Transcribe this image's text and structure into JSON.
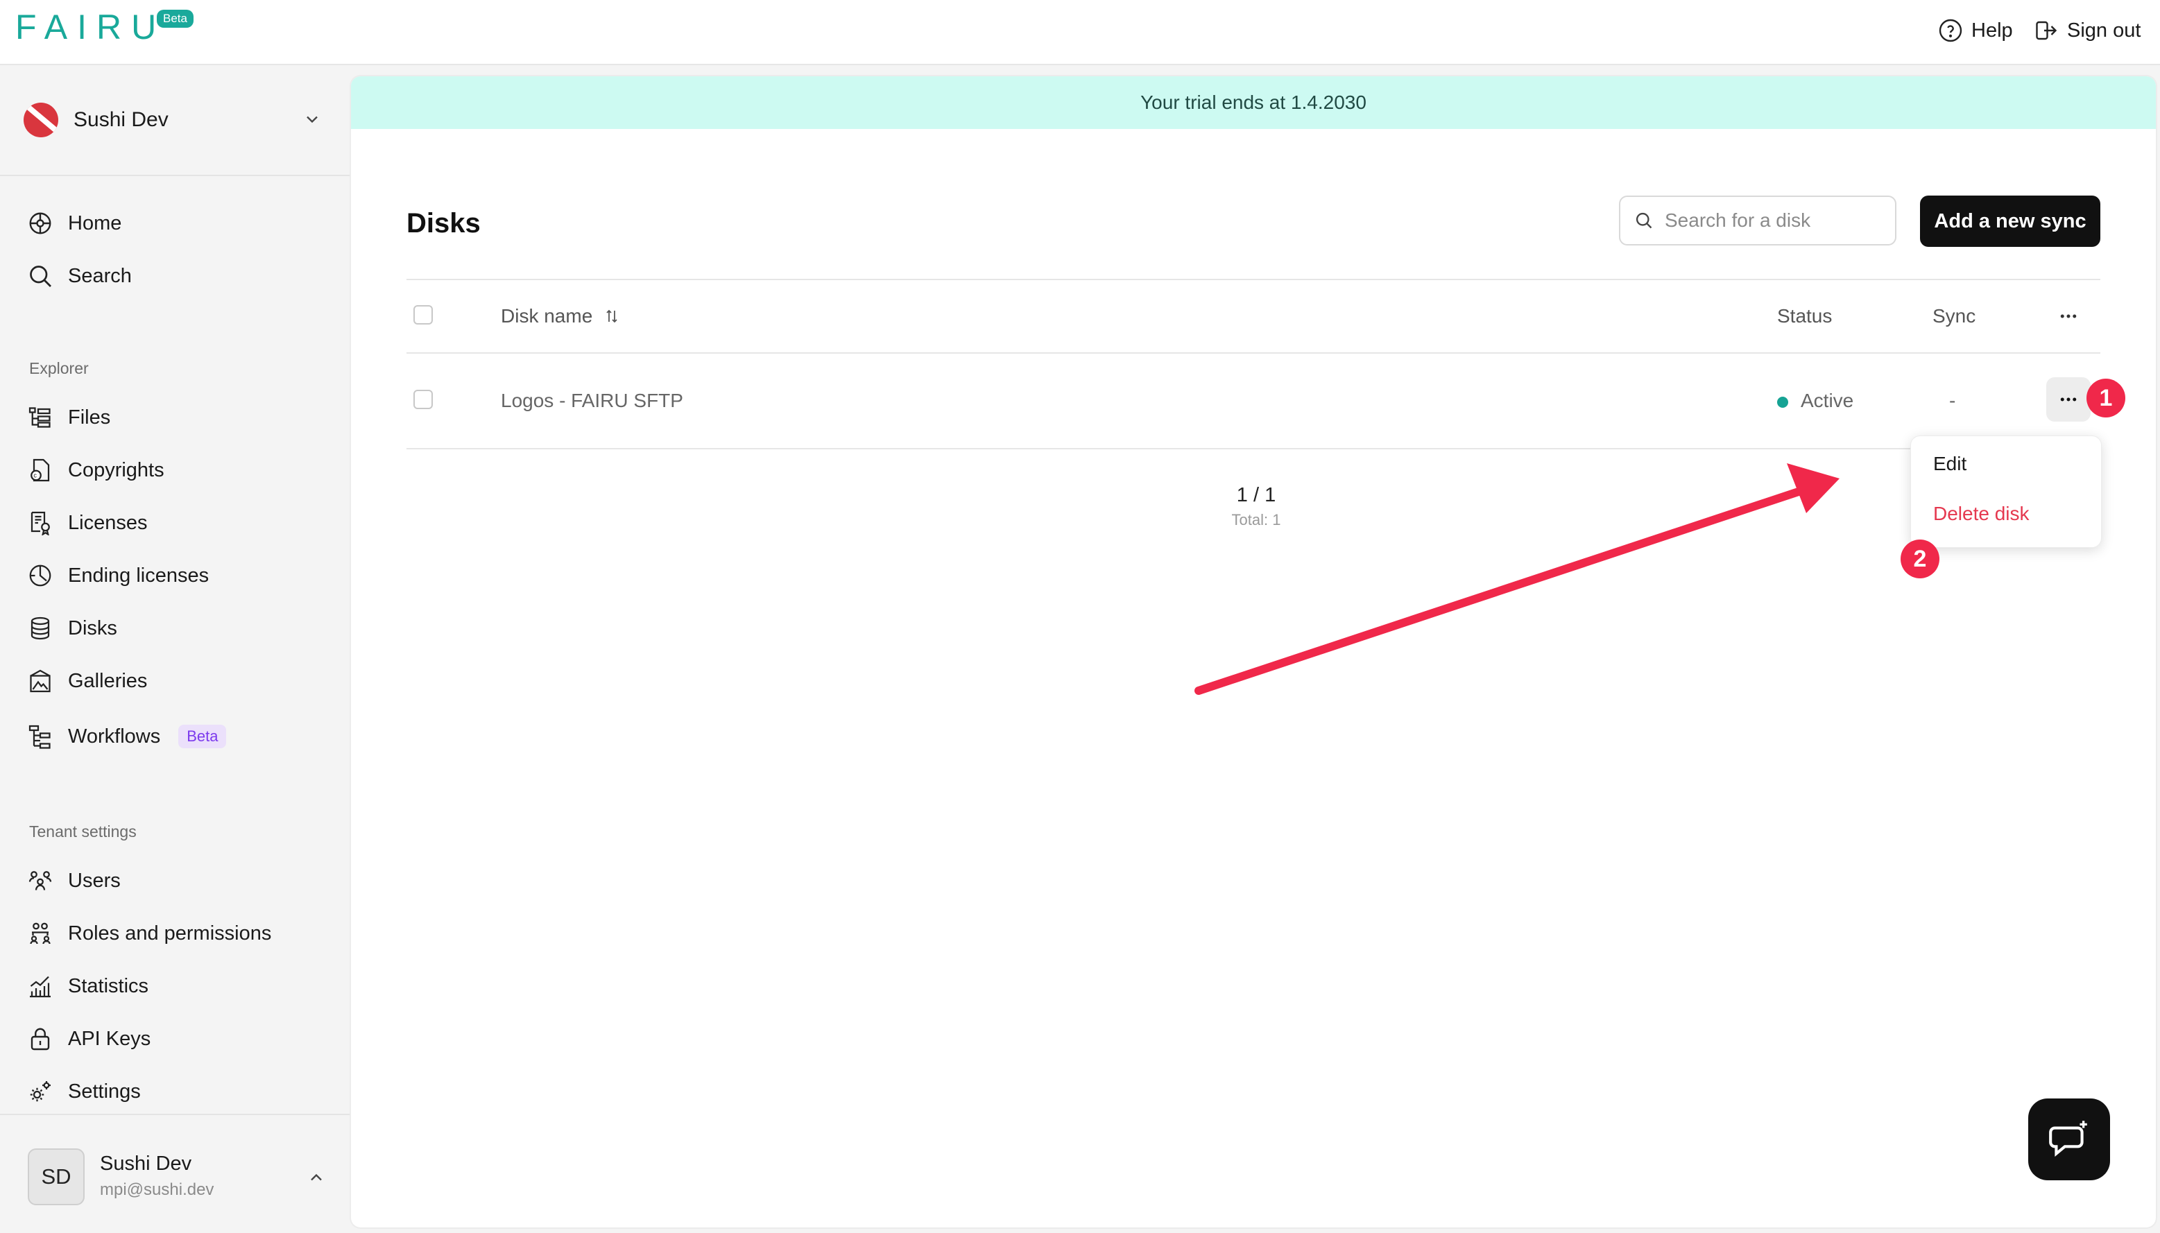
{
  "topbar": {
    "logo_text": "FAIRU",
    "logo_badge": "Beta",
    "help_label": "Help",
    "signout_label": "Sign out"
  },
  "sidebar": {
    "tenant_name": "Sushi Dev",
    "main_items": [
      {
        "label": "Home",
        "icon": "home-icon"
      },
      {
        "label": "Search",
        "icon": "search-icon"
      }
    ],
    "explorer_heading": "Explorer",
    "explorer_items": [
      {
        "label": "Files",
        "icon": "files-icon"
      },
      {
        "label": "Copyrights",
        "icon": "copyright-icon"
      },
      {
        "label": "Licenses",
        "icon": "licenses-icon"
      },
      {
        "label": "Ending licenses",
        "icon": "ending-licenses-icon"
      },
      {
        "label": "Disks",
        "icon": "disks-icon"
      },
      {
        "label": "Galleries",
        "icon": "galleries-icon"
      },
      {
        "label": "Workflows",
        "icon": "workflows-icon",
        "badge": "Beta"
      }
    ],
    "tenant_heading": "Tenant settings",
    "tenant_items": [
      {
        "label": "Users",
        "icon": "users-icon"
      },
      {
        "label": "Roles and permissions",
        "icon": "roles-icon"
      },
      {
        "label": "Statistics",
        "icon": "statistics-icon"
      },
      {
        "label": "API Keys",
        "icon": "lock-icon"
      },
      {
        "label": "Settings",
        "icon": "gear-icon"
      }
    ],
    "user": {
      "initials": "SD",
      "name": "Sushi Dev",
      "email": "mpi@sushi.dev"
    }
  },
  "main": {
    "trial_banner": "Your trial ends at 1.4.2030",
    "title": "Disks",
    "search_placeholder": "Search for a disk",
    "add_button": "Add a new sync",
    "columns": {
      "name": "Disk name",
      "status": "Status",
      "sync": "Sync"
    },
    "rows": [
      {
        "name": "Logos - FAIRU SFTP",
        "status": "Active",
        "sync": "-"
      }
    ],
    "pagination": {
      "page": "1 / 1",
      "total": "Total: 1"
    },
    "row_menu": {
      "edit": "Edit",
      "delete": "Delete disk"
    },
    "annotations": [
      "1",
      "2"
    ]
  },
  "colors": {
    "accent": "#19a99a",
    "trial_bg": "#cdfaf2",
    "status_active": "#16a394",
    "danger": "#e5384f",
    "annotation": "#f0284a"
  }
}
